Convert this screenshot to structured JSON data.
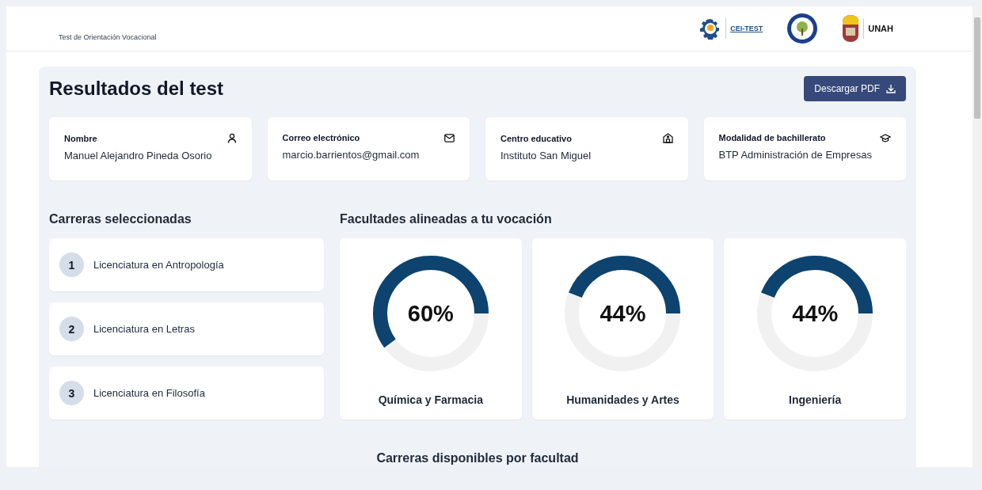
{
  "header": {
    "subtitle": "Test de Orientación Vocacional",
    "logos": [
      {
        "kind": "gear",
        "text": "CEI-TEST"
      },
      {
        "kind": "seal"
      },
      {
        "kind": "shield",
        "text": "UNAH"
      }
    ]
  },
  "results": {
    "title": "Resultados del test",
    "download_button": "Descargar PDF",
    "info_cards": [
      {
        "label": "Nombre",
        "value": "Manuel Alejandro Pineda Osorio",
        "kind": "user"
      },
      {
        "label": "Correo electrónico",
        "value": "marcio.barrientos@gmail.com",
        "kind": "mail"
      },
      {
        "label": "Centro educativo",
        "value": "Instituto San Miguel",
        "kind": "school"
      },
      {
        "label": "Modalidad de bachillerato",
        "value": "BTP Administración de Empresas",
        "kind": "cap"
      }
    ],
    "careers": {
      "title": "Carreras seleccionadas",
      "items": [
        {
          "number": "1",
          "name": "Licenciatura en Antropología"
        },
        {
          "number": "2",
          "name": "Licenciatura en Letras"
        },
        {
          "number": "3",
          "name": "Licenciatura en Filosofía"
        }
      ]
    },
    "faculties": {
      "title": "Facultades alineadas a tu vocación",
      "items": [
        {
          "percent": "60%",
          "level": 0.6,
          "name": "Química y Farmacia"
        },
        {
          "percent": "44%",
          "level": 0.44,
          "name": "Humanidades y Artes"
        },
        {
          "percent": "44%",
          "level": 0.44,
          "name": "Ingeniería"
        }
      ]
    },
    "available_title": "Carreras disponibles por facultad"
  }
}
